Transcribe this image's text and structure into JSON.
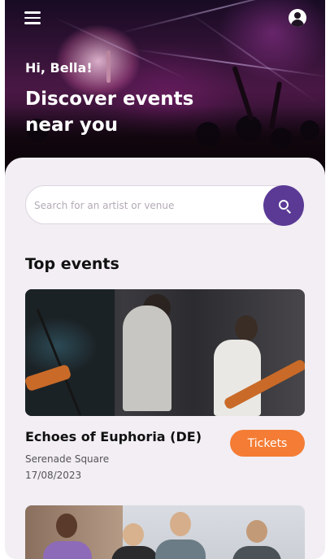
{
  "header": {
    "menu_icon": "hamburger-menu-icon",
    "profile_icon": "user-account-icon",
    "greeting": "Hi, Bella!",
    "headline": "Discover events near you"
  },
  "search": {
    "placeholder": "Search for an artist or venue",
    "value": "",
    "button_icon": "search-icon",
    "button_color": "#5b3a96"
  },
  "top_events": {
    "title": "Top events",
    "items": [
      {
        "name": "Echoes of Euphoria (DE)",
        "venue": "Serenade Square",
        "date": "17/08/2023",
        "tickets_label": "Tickets",
        "tickets_color": "#f47c34"
      }
    ]
  }
}
